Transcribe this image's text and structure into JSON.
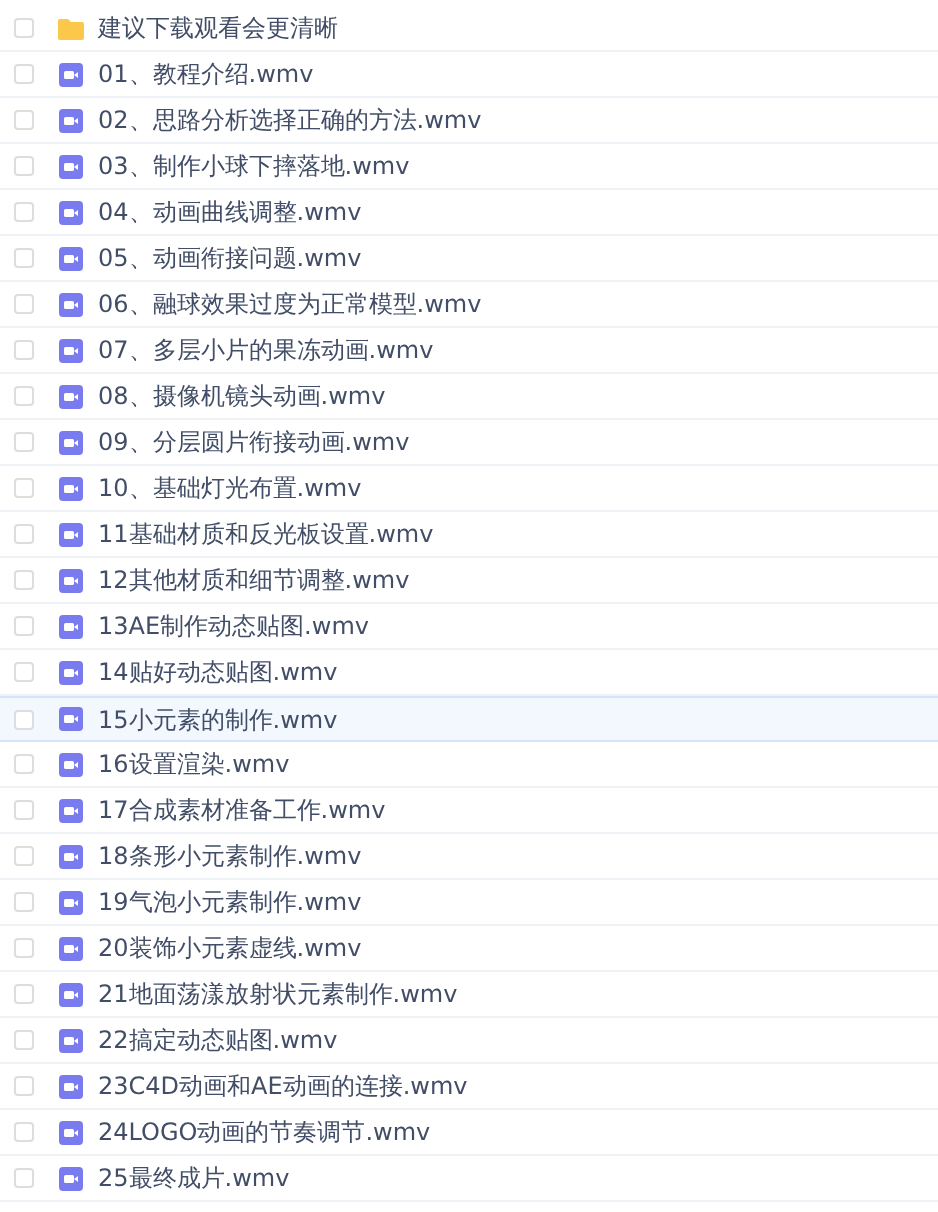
{
  "files": [
    {
      "kind": "folder",
      "name": "建议下载观看会更清晰",
      "checked": false,
      "selected": false
    },
    {
      "kind": "video",
      "name": "01、教程介绍.wmv",
      "checked": false,
      "selected": false
    },
    {
      "kind": "video",
      "name": "02、思路分析选择正确的方法.wmv",
      "checked": false,
      "selected": false
    },
    {
      "kind": "video",
      "name": "03、制作小球下摔落地.wmv",
      "checked": false,
      "selected": false
    },
    {
      "kind": "video",
      "name": "04、动画曲线调整.wmv",
      "checked": false,
      "selected": false
    },
    {
      "kind": "video",
      "name": "05、动画衔接问题.wmv",
      "checked": false,
      "selected": false
    },
    {
      "kind": "video",
      "name": "06、融球效果过度为正常模型.wmv",
      "checked": false,
      "selected": false
    },
    {
      "kind": "video",
      "name": "07、多层小片的果冻动画.wmv",
      "checked": false,
      "selected": false
    },
    {
      "kind": "video",
      "name": "08、摄像机镜头动画.wmv",
      "checked": false,
      "selected": false
    },
    {
      "kind": "video",
      "name": "09、分层圆片衔接动画.wmv",
      "checked": false,
      "selected": false
    },
    {
      "kind": "video",
      "name": "10、基础灯光布置.wmv",
      "checked": false,
      "selected": false
    },
    {
      "kind": "video",
      "name": "11基础材质和反光板设置.wmv",
      "checked": false,
      "selected": false
    },
    {
      "kind": "video",
      "name": "12其他材质和细节调整.wmv",
      "checked": false,
      "selected": false
    },
    {
      "kind": "video",
      "name": "13AE制作动态贴图.wmv",
      "checked": false,
      "selected": false
    },
    {
      "kind": "video",
      "name": "14贴好动态贴图.wmv",
      "checked": false,
      "selected": false
    },
    {
      "kind": "video",
      "name": "15小元素的制作.wmv",
      "checked": false,
      "selected": true
    },
    {
      "kind": "video",
      "name": "16设置渲染.wmv",
      "checked": false,
      "selected": false
    },
    {
      "kind": "video",
      "name": "17合成素材准备工作.wmv",
      "checked": false,
      "selected": false
    },
    {
      "kind": "video",
      "name": "18条形小元素制作.wmv",
      "checked": false,
      "selected": false
    },
    {
      "kind": "video",
      "name": "19气泡小元素制作.wmv",
      "checked": false,
      "selected": false
    },
    {
      "kind": "video",
      "name": "20装饰小元素虚线.wmv",
      "checked": false,
      "selected": false
    },
    {
      "kind": "video",
      "name": "21地面荡漾放射状元素制作.wmv",
      "checked": false,
      "selected": false
    },
    {
      "kind": "video",
      "name": "22搞定动态贴图.wmv",
      "checked": false,
      "selected": false
    },
    {
      "kind": "video",
      "name": "23C4D动画和AE动画的连接.wmv",
      "checked": false,
      "selected": false
    },
    {
      "kind": "video",
      "name": "24LOGO动画的节奏调节.wmv",
      "checked": false,
      "selected": false
    },
    {
      "kind": "video",
      "name": "25最终成片.wmv",
      "checked": false,
      "selected": false
    }
  ]
}
